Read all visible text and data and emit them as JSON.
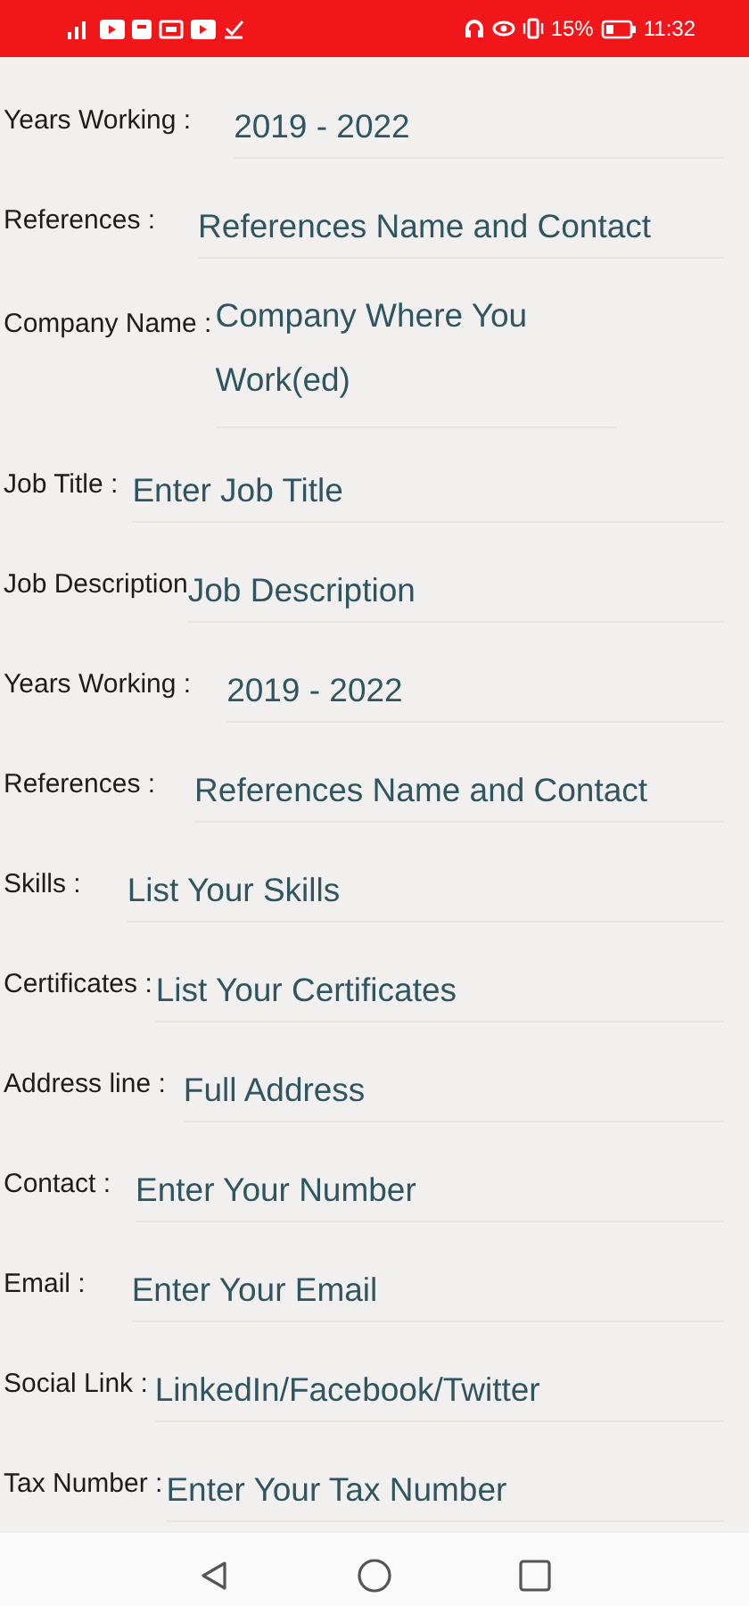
{
  "status_bar": {
    "battery_percent": "15%",
    "time": "11:32"
  },
  "fields": [
    {
      "label": "Years Working :",
      "placeholder": "2019 - 2022",
      "kind": "text"
    },
    {
      "label": "References :",
      "placeholder": "References Name and Contact",
      "kind": "text"
    },
    {
      "label": "Company Name :",
      "placeholder": "Company Where You Work(ed)",
      "kind": "multiline"
    },
    {
      "label": "Job Title :",
      "placeholder": "Enter Job Title",
      "kind": "text"
    },
    {
      "label": "Job Description",
      "placeholder": "Job Description",
      "kind": "text"
    },
    {
      "label": "Years Working :",
      "placeholder": "2019 - 2022",
      "kind": "text"
    },
    {
      "label": "References :",
      "placeholder": "References Name and Contact",
      "kind": "text"
    },
    {
      "label": "Skills :",
      "placeholder": "List Your Skills",
      "kind": "text"
    },
    {
      "label": "Certificates :",
      "placeholder": "List Your Certificates",
      "kind": "text"
    },
    {
      "label": "Address line :",
      "placeholder": "Full Address",
      "kind": "text"
    },
    {
      "label": "Contact :",
      "placeholder": "Enter Your Number",
      "kind": "text"
    },
    {
      "label": "Email :",
      "placeholder": "Enter Your Email",
      "kind": "text"
    },
    {
      "label": "Social Link :",
      "placeholder": "LinkedIn/Facebook/Twitter",
      "kind": "text"
    },
    {
      "label": "Tax Number :",
      "placeholder": "Enter Your Tax Number",
      "kind": "text"
    }
  ]
}
